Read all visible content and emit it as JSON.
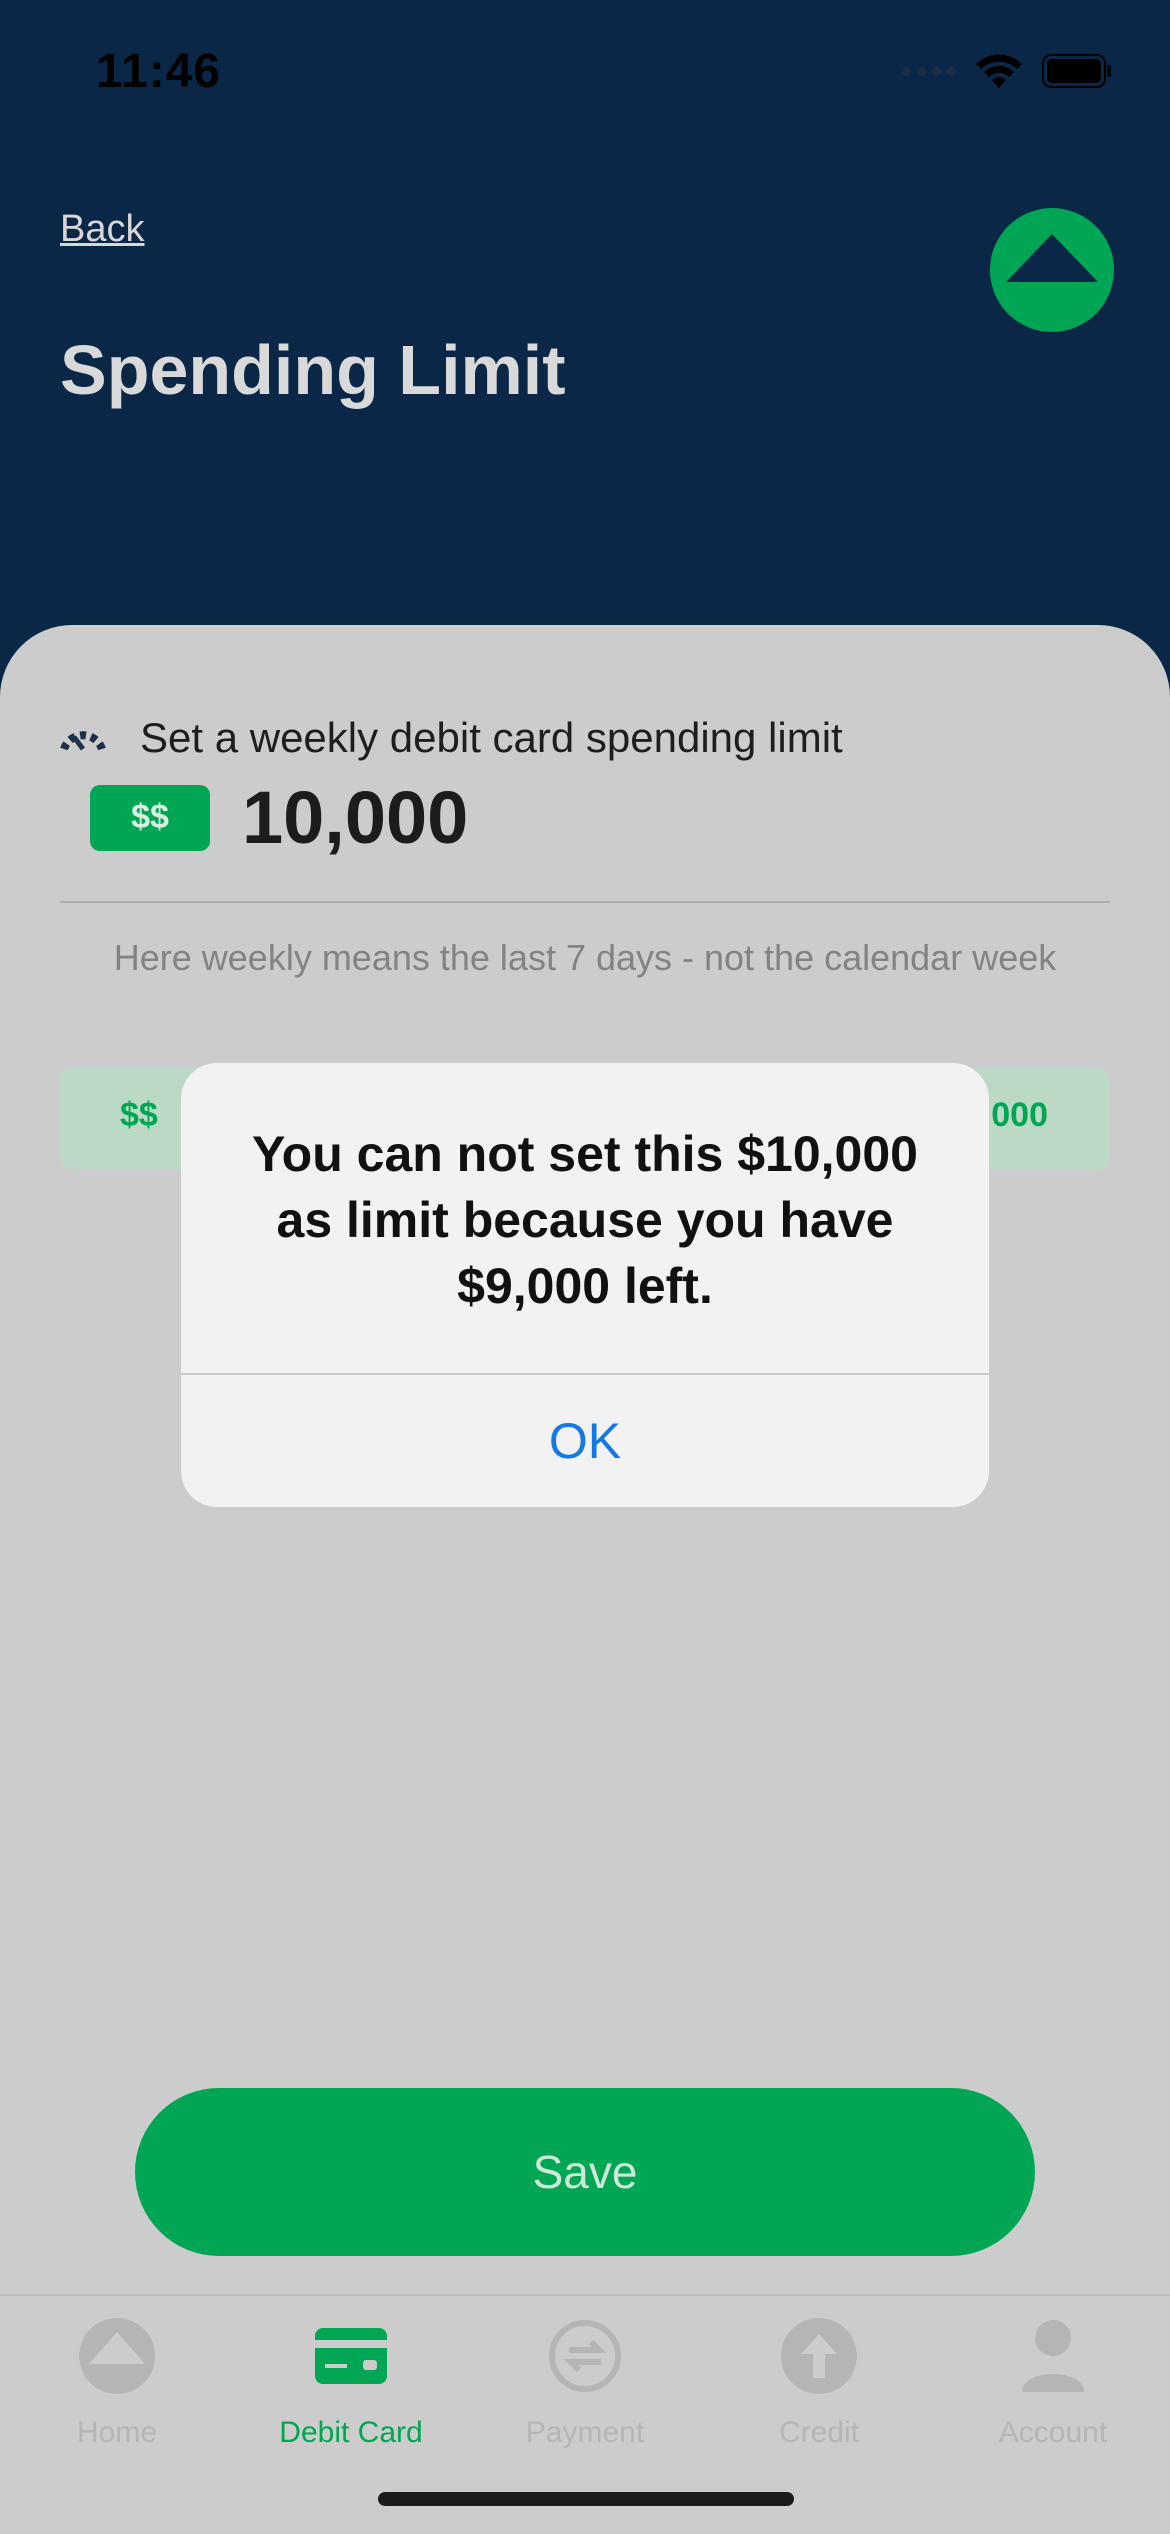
{
  "status_bar": {
    "time": "11:46"
  },
  "header": {
    "back_label": "Back",
    "title": "Spending Limit"
  },
  "limit": {
    "label": "Set a weekly debit card spending limit",
    "currency_badge": "$$",
    "amount": "10,000",
    "hint": "Here weekly means the last 7 days - not the calendar week"
  },
  "preset": {
    "left_label": "$$",
    "right_label": "000"
  },
  "save_label": "Save",
  "alert": {
    "message": "You can not set this $10,000 as limit because you have $9,000 left.",
    "ok_label": "OK"
  },
  "tabs": [
    {
      "label": "Home",
      "icon": "home-logo-icon",
      "active": false
    },
    {
      "label": "Debit Card",
      "icon": "card-icon",
      "active": true
    },
    {
      "label": "Payment",
      "icon": "transfer-icon",
      "active": false
    },
    {
      "label": "Credit",
      "icon": "arrow-up-icon",
      "active": false
    },
    {
      "label": "Account",
      "icon": "person-icon",
      "active": false
    }
  ],
  "colors": {
    "brand_green": "#00a653",
    "header_navy": "#0a2747",
    "alert_ok_blue": "#1479e6"
  }
}
